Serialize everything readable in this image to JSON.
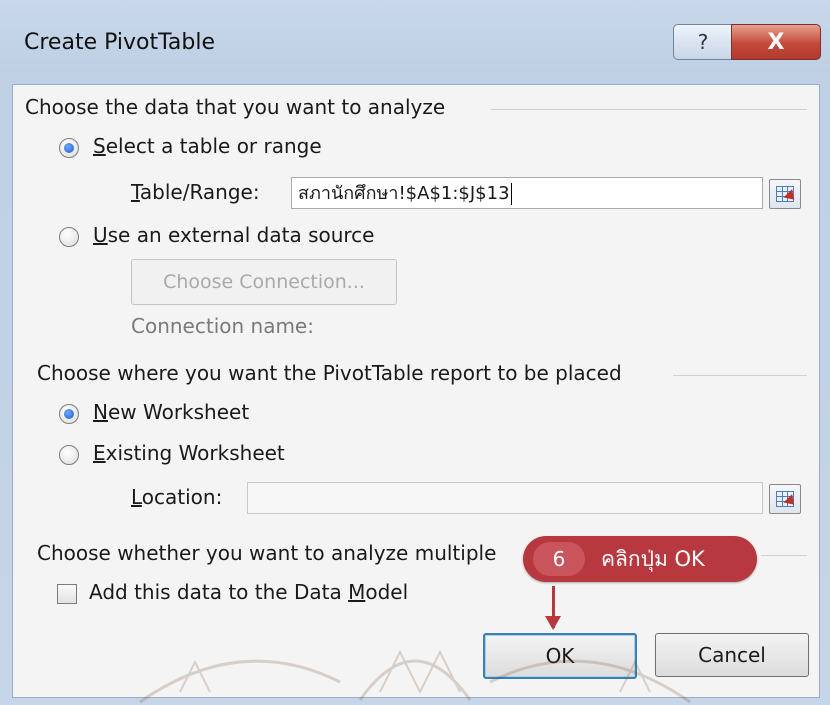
{
  "window": {
    "title": "Create PivotTable",
    "help_glyph": "?",
    "close_glyph": "X"
  },
  "section_data": {
    "heading": "Choose the data that you want to analyze",
    "select_range": {
      "label_mnemonic": "S",
      "label_rest": "elect a table or range",
      "checked": true
    },
    "table_range": {
      "label_mnemonic": "T",
      "label_rest": "able/Range:",
      "value": "สภานักศึกษา!$A$1:$J$13"
    },
    "external": {
      "label_mnemonic": "U",
      "label_rest": "se an external data source",
      "checked": false
    },
    "choose_connection_label": "Choose Connection...",
    "connection_name_label": "Connection name:"
  },
  "section_place": {
    "heading": "Choose where you want the PivotTable report to be placed",
    "new_worksheet": {
      "label_mnemonic": "N",
      "label_rest": "ew Worksheet",
      "checked": true
    },
    "existing_worksheet": {
      "label_mnemonic": "E",
      "label_rest": "xisting Worksheet",
      "checked": false
    },
    "location": {
      "label_mnemonic": "L",
      "label_rest": "ocation:",
      "value": ""
    }
  },
  "section_multiple": {
    "heading": "Choose whether you want to analyze multiple",
    "data_model": {
      "label_before": "Add this data to the Data ",
      "label_mnemonic": "M",
      "label_after": "odel",
      "checked": false
    }
  },
  "buttons": {
    "ok": "OK",
    "cancel": "Cancel"
  },
  "callout": {
    "step": "6",
    "text": "คลิกปุ่ม OK",
    "color": "#b8383f"
  },
  "colors": {
    "close_button": "#c44a3b",
    "radio_selected": "#1d5fc7",
    "ok_border": "#3c7fb1"
  }
}
